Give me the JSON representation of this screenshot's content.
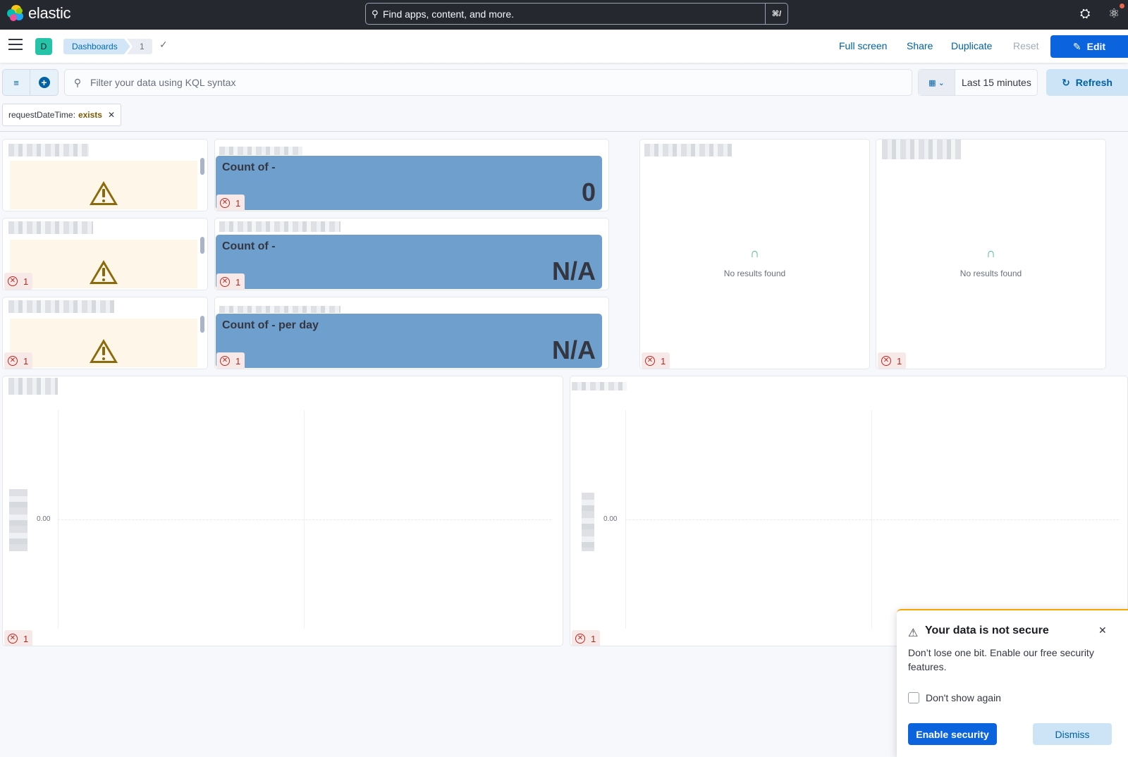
{
  "app": {
    "logo_text": "elastic",
    "search_placeholder": "Find apps, content, and more.",
    "search_shortcut": "⌘/"
  },
  "subheader": {
    "space_initial": "D",
    "breadcrumbs": [
      "Dashboards",
      "1"
    ],
    "actions": {
      "full_screen": "Full screen",
      "share": "Share",
      "duplicate": "Duplicate",
      "reset": "Reset",
      "edit": "Edit"
    }
  },
  "query": {
    "kql_placeholder": "Filter your data using KQL syntax",
    "date_range": "Last 15 minutes",
    "refresh": "Refresh"
  },
  "filter_pill": {
    "field": "requestDateTime:",
    "operator": "exists"
  },
  "panels": {
    "error_count": "1",
    "metrics": [
      {
        "title": "Count of -",
        "value": "0"
      },
      {
        "title": "Count of -",
        "value": "N/A"
      },
      {
        "title": "Count of - per day",
        "value": "N/A"
      }
    ],
    "no_results": "No results found",
    "chart_zero_tick": "0.00"
  },
  "toast": {
    "title": "Your data is not secure",
    "text": "Don’t lose one bit. Enable our free security features.",
    "checkbox_label": "Don't show again",
    "primary": "Enable security",
    "secondary": "Dismiss"
  },
  "colors": {
    "header_bg": "#25282f",
    "primary": "#0b64dd",
    "metric_bg": "#6f9fcc",
    "warning_bg": "#fef7e9",
    "error": "#bd271e"
  }
}
